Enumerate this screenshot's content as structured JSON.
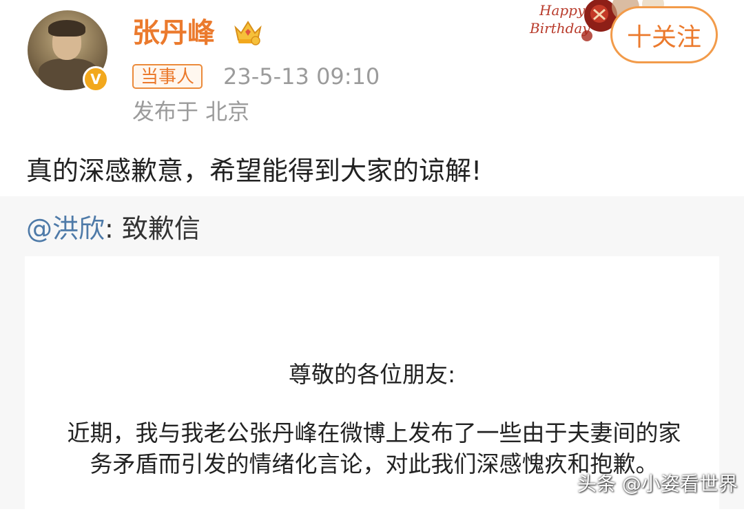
{
  "post": {
    "username": "张丹峰",
    "tag": "当事人",
    "time": "23-5-13 09:10",
    "location": "发布于 北京",
    "follow_label": "十关注",
    "content": "真的深感歉意，希望能得到大家的谅解!",
    "decoration": {
      "line1": "Happy",
      "line2": "Birthday"
    }
  },
  "repost": {
    "mention": "@洪欣",
    "title": ": 致歉信",
    "letter": {
      "greeting": "尊敬的各位朋友:",
      "paragraph": "近期，我与我老公张丹峰在微博上发布了一些由于夫妻间的家务矛盾而引发的情绪化言论，对此我们深感愧疚和抱歉。"
    }
  },
  "watermark": "头条 @小姿看世界",
  "colors": {
    "accent": "#eb7a2d",
    "mention": "#4e7aa8",
    "meta": "#9b9b9b",
    "verified": "#f2a81d"
  }
}
